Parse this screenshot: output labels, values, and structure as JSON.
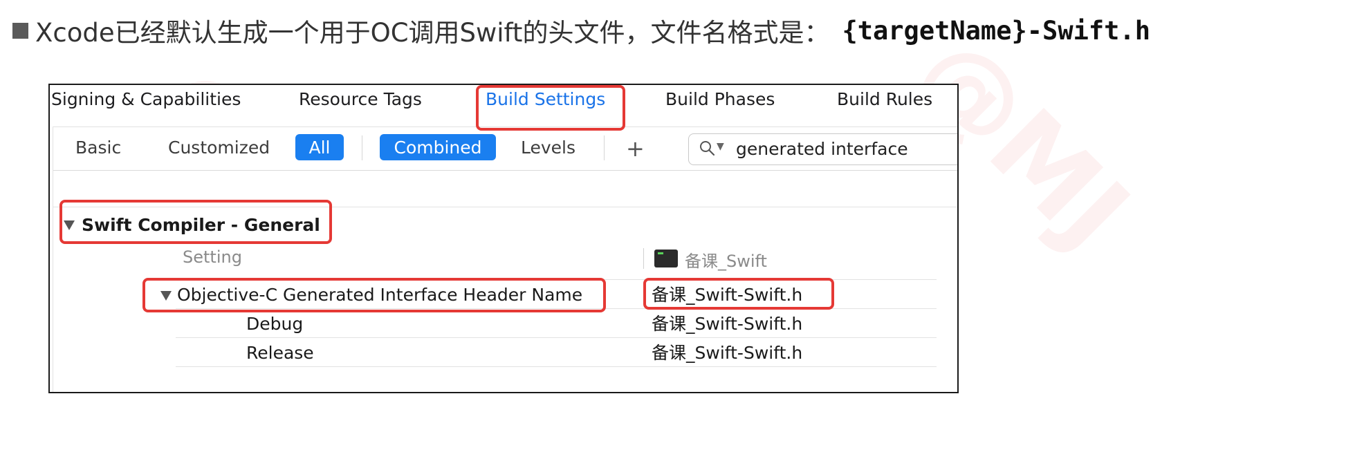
{
  "caption": {
    "text": "Xcode已经默认生成一个用于OC调用Swift的头文件，文件名格式是：",
    "code": "{targetName}-Swift.h"
  },
  "tabs": [
    {
      "label": "Signing & Capabilities",
      "active": false
    },
    {
      "label": "Resource Tags",
      "active": false
    },
    {
      "label": "Build Settings",
      "active": true
    },
    {
      "label": "Build Phases",
      "active": false
    },
    {
      "label": "Build Rules",
      "active": false
    }
  ],
  "filters": {
    "basic": "Basic",
    "customized": "Customized",
    "all": "All",
    "combined": "Combined",
    "levels": "Levels",
    "add": "+"
  },
  "search": {
    "value": "generated interface",
    "icon": "magnifier-icon"
  },
  "section": {
    "title": "Swift Compiler - General"
  },
  "table": {
    "setting_header": "Setting",
    "target_header": "备课_Swift",
    "rows": [
      {
        "name": "Objective-C Generated Interface Header Name",
        "value": "备课_Swift-Swift.h",
        "expanded": true
      },
      {
        "name": "Debug",
        "value": "备课_Swift-Swift.h"
      },
      {
        "name": "Release",
        "value": "备课_Swift-Swift.h"
      }
    ]
  },
  "colors": {
    "accent": "#1a7ff0",
    "highlight_box": "#e53935",
    "active_tab": "#1a73e8"
  }
}
